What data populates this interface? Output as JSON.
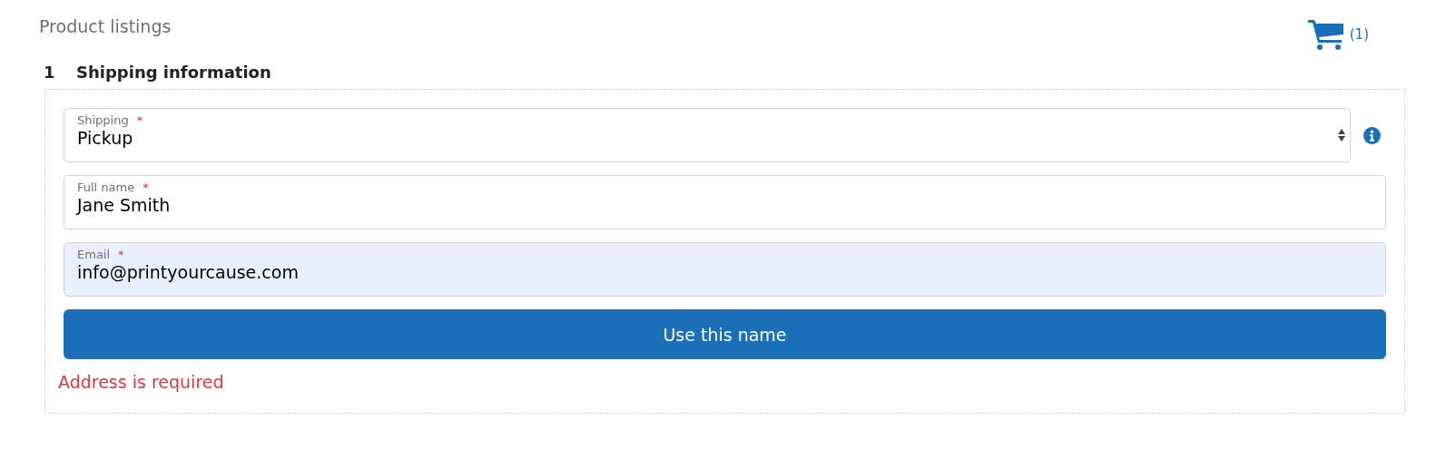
{
  "header": {
    "title": "Product listings",
    "cart_count": "(1)"
  },
  "section": {
    "number": "1",
    "title": "Shipping information"
  },
  "fields": [
    {
      "kind": "select",
      "label": "Shipping",
      "required_mark": "*",
      "value": "Pickup",
      "autofilled": false,
      "info": true
    },
    {
      "kind": "text",
      "label": "Full name",
      "required_mark": "*",
      "value": "Jane Smith",
      "autofilled": false,
      "info": false
    },
    {
      "kind": "text",
      "label": "Email",
      "required_mark": "*",
      "value": "info@printyourcause.com",
      "autofilled": true,
      "info": false
    }
  ],
  "submit_button": "Use this name",
  "error": "Address is required"
}
